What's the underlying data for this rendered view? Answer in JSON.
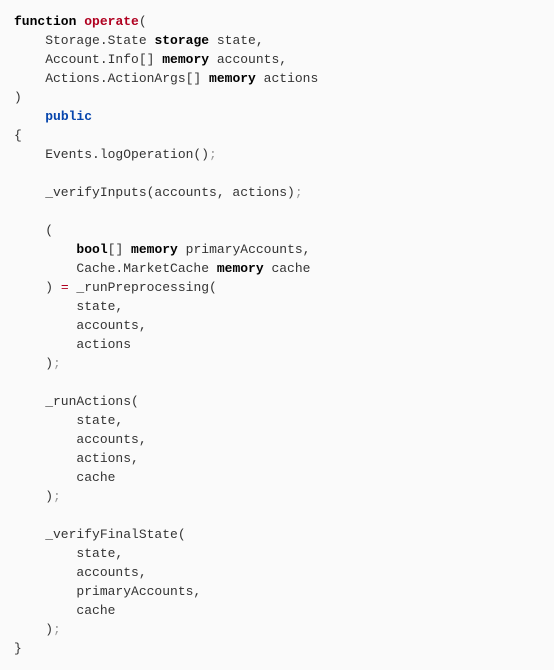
{
  "code": {
    "l1_kw": "function",
    "l1_fn": "operate",
    "l1_tail": "(",
    "l2_a": "    Storage.State ",
    "l2_mem": "storage",
    "l2_b": " state,",
    "l3_a": "    Account.Info[] ",
    "l3_mem": "memory",
    "l3_b": " accounts,",
    "l4_a": "    Actions.ActionArgs[] ",
    "l4_mem": "memory",
    "l4_b": " actions",
    "l5": ")",
    "l6_mod": "public",
    "l7": "{",
    "l8_a": "    Events.logOperation()",
    "l8_sc": ";",
    "l9": "",
    "l10_a": "    _verifyInputs(accounts, actions)",
    "l10_sc": ";",
    "l11": "",
    "l12": "    (",
    "l13_a": "        ",
    "l13_kw": "bool",
    "l13_b": "[] ",
    "l13_mem": "memory",
    "l13_c": " primaryAccounts,",
    "l14_a": "        Cache.MarketCache ",
    "l14_mem": "memory",
    "l14_b": " cache",
    "l15_a": "    ) ",
    "l15_eq": "=",
    "l15_b": " _runPreprocessing(",
    "l16": "        state,",
    "l17": "        accounts,",
    "l18": "        actions",
    "l19_a": "    )",
    "l19_sc": ";",
    "l20": "",
    "l21": "    _runActions(",
    "l22": "        state,",
    "l23": "        accounts,",
    "l24": "        actions,",
    "l25": "        cache",
    "l26_a": "    )",
    "l26_sc": ";",
    "l27": "",
    "l28": "    _verifyFinalState(",
    "l29": "        state,",
    "l30": "        accounts,",
    "l31": "        primaryAccounts,",
    "l32": "        cache",
    "l33_a": "    )",
    "l33_sc": ";",
    "l34": "}"
  }
}
